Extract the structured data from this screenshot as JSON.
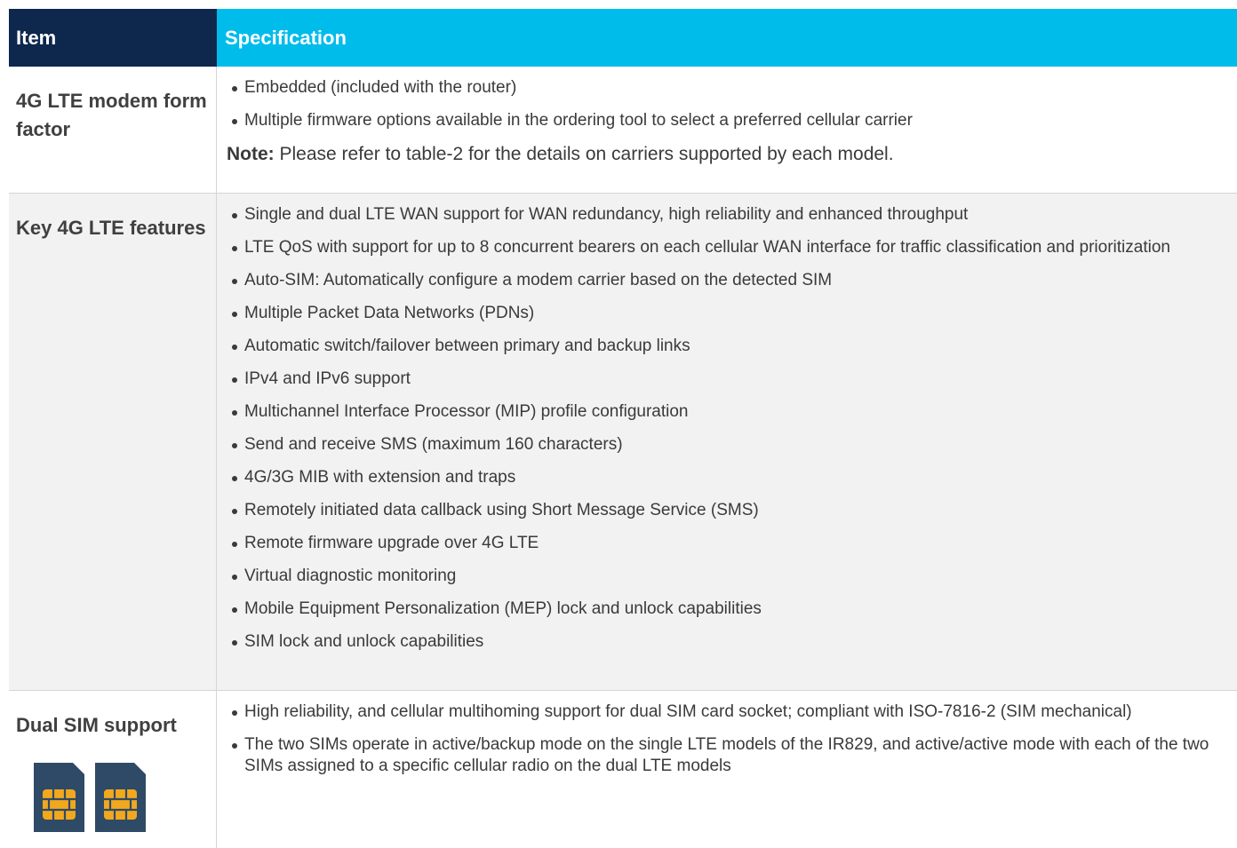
{
  "header": {
    "item": "Item",
    "spec": "Specification"
  },
  "rows": [
    {
      "item": "4G LTE modem form factor",
      "bullets": [
        "Embedded (included with the router)",
        "Multiple firmware options available in the ordering tool to select a preferred cellular carrier"
      ],
      "note_label": "Note:",
      "note_text": " Please refer to table-2 for the details on carriers supported by each model."
    },
    {
      "item": "Key 4G LTE features",
      "bullets": [
        "Single and dual LTE WAN support for WAN redundancy, high reliability and enhanced throughput",
        "LTE QoS with support for up to 8 concurrent bearers on each cellular WAN interface for traffic classification and prioritization",
        "Auto-SIM: Automatically configure a modem carrier based on the detected SIM",
        "Multiple Packet Data Networks (PDNs)",
        "Automatic switch/failover between primary and backup links",
        "IPv4 and IPv6 support",
        "Multichannel Interface Processor (MIP) profile configuration",
        "Send and receive SMS (maximum 160 characters)",
        "4G/3G MIB with extension and traps",
        "Remotely initiated data callback using Short Message Service (SMS)",
        "Remote firmware upgrade over 4G LTE",
        "Virtual diagnostic monitoring",
        "Mobile Equipment Personalization (MEP) lock and unlock capabilities",
        "SIM lock and unlock capabilities"
      ]
    },
    {
      "item": "Dual SIM support",
      "icons": [
        "sim-card-icon",
        "sim-card-icon"
      ],
      "bullets": [
        "High reliability, and cellular multihoming support for dual SIM card socket; compliant with ISO-7816-2 (SIM mechanical)",
        "The two SIMs operate in active/backup mode on the single LTE models of the IR829, and active/active mode with each of the two SIMs assigned to a specific cellular radio on the dual LTE models"
      ]
    }
  ],
  "colors": {
    "header_item_bg": "#0d274d",
    "header_spec_bg": "#00bceb",
    "row_alt_bg": "#f2f2f2",
    "sim_body": "#2f4a66",
    "sim_chip": "#f2a81d"
  }
}
